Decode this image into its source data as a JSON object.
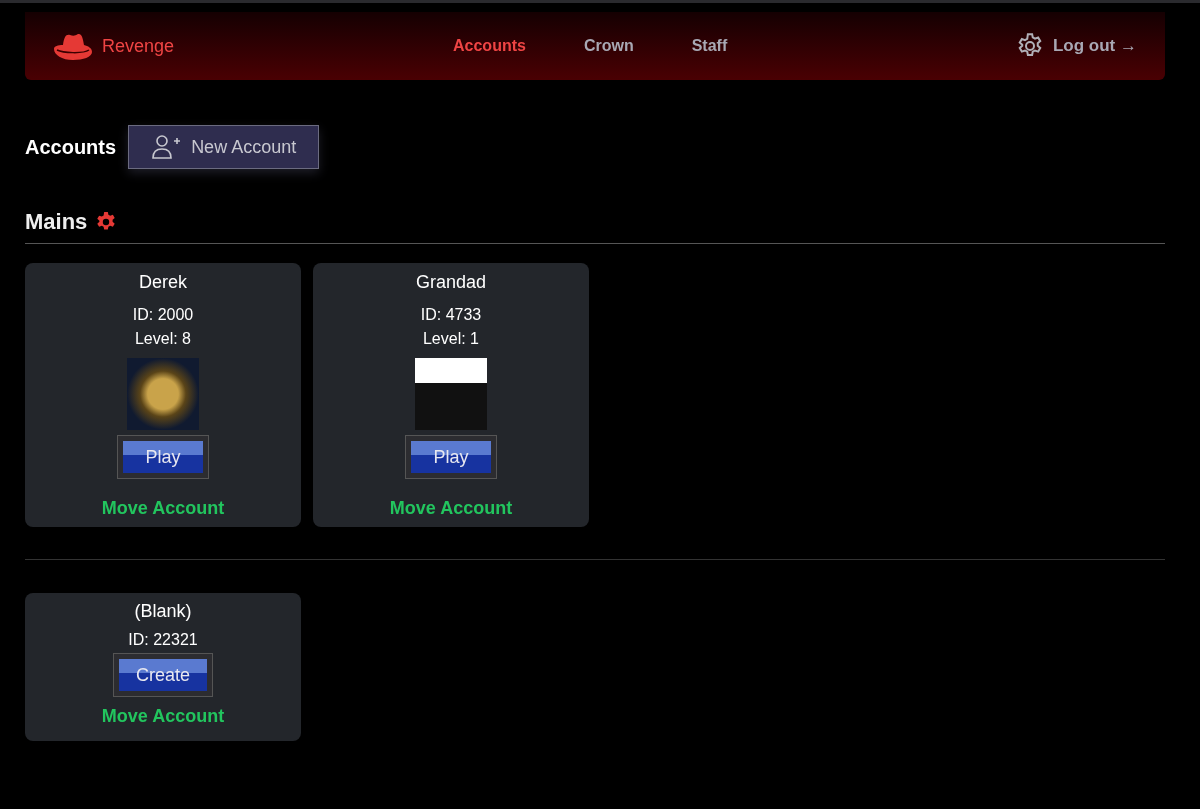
{
  "brand": "Revenge",
  "nav": [
    {
      "label": "Accounts",
      "selected": true
    },
    {
      "label": "Crown",
      "selected": false
    },
    {
      "label": "Staff",
      "selected": false
    }
  ],
  "logout": "Log out →",
  "title": "Accounts",
  "new_account_button": "New Account",
  "section_title": "Mains",
  "mains": [
    {
      "kind": "account",
      "name": "Derek",
      "id": "ID: 2000",
      "level": "Level: 8",
      "button": "Play",
      "move": "Move Account"
    },
    {
      "kind": "account",
      "name": "Grandad",
      "id": "ID: 4733",
      "level": "Level: 1",
      "button": "Play",
      "move": "Move Account"
    }
  ],
  "others": [
    {
      "kind": "blank",
      "name": "(Blank)",
      "id": "ID: 22321",
      "button": "Create",
      "move": "Move Account"
    }
  ]
}
